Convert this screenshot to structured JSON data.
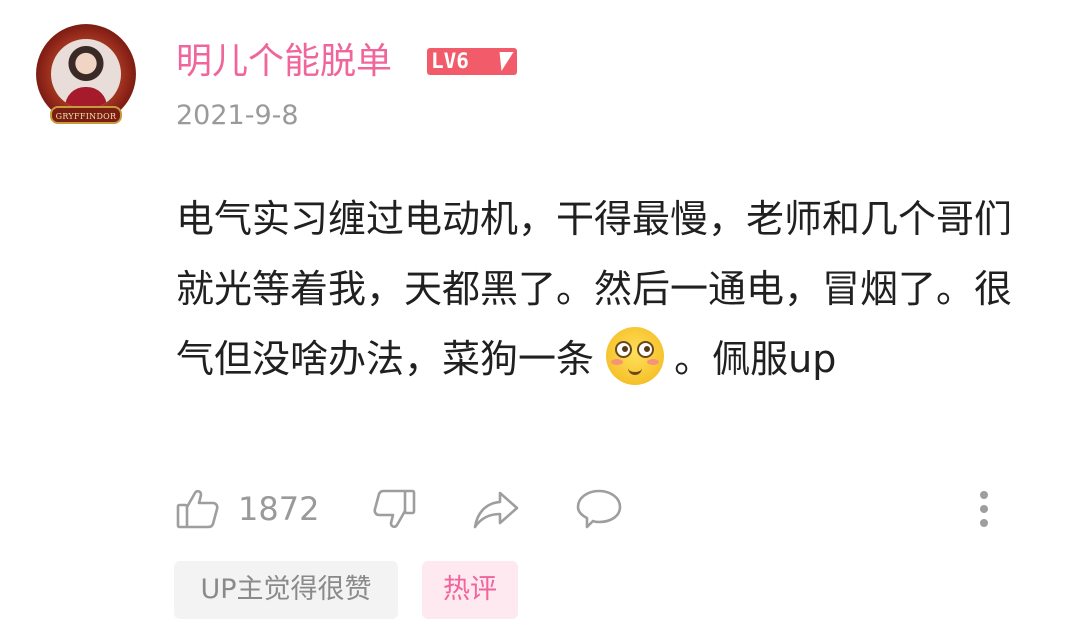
{
  "comment": {
    "username": "明儿个能脱单",
    "level_badge": "LV6",
    "avatar_banner": "GRYFFINDOR",
    "date": "2021-9-8",
    "text_part1": "电气实习缠过电动机，干得最慢，老师和几个哥们就光等着我，天都黑了。然后一通电，冒烟了。很气但没啥办法，菜狗一条",
    "emoji": "flushed-face-icon",
    "text_part2": "。佩服up",
    "likes": "1872",
    "tags": {
      "up_liked": "UP主觉得很赞",
      "hot": "热评"
    }
  },
  "colors": {
    "username": "#f0659a",
    "level_badge_bg": "#f25b6a",
    "muted_text": "#9a9a9a",
    "body_text": "#202020",
    "icon_gray": "#9e9e9e",
    "hot_tag_bg": "#fde9ef"
  },
  "icons": [
    "thumbs-up-icon",
    "thumbs-down-icon",
    "share-arrow-icon",
    "reply-bubble-icon",
    "more-vertical-icon"
  ]
}
